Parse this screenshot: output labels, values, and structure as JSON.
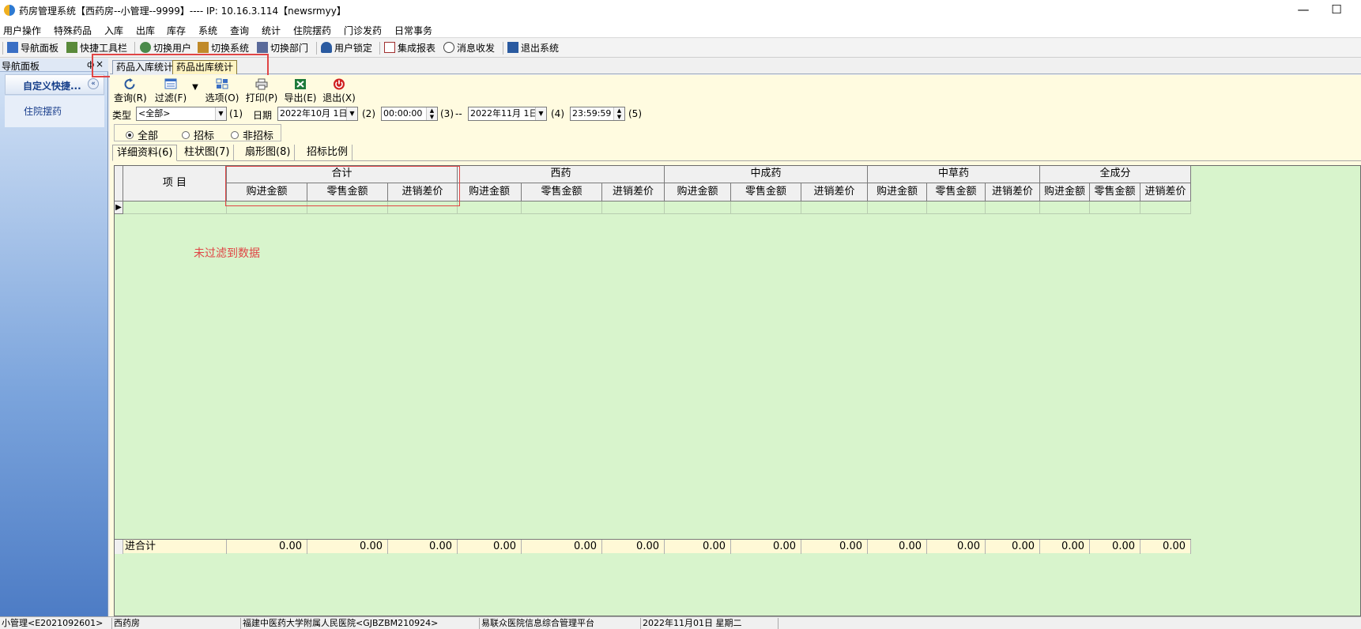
{
  "window": {
    "title": "药房管理系统【西药房--小管理--9999】---- IP: 10.16.3.114【newsrmyy】",
    "minimize": "—",
    "maximize": "☐"
  },
  "menu": [
    "用户操作",
    "特殊药品",
    "入库",
    "出库",
    "库存",
    "系统",
    "查询",
    "统计",
    "住院摆药",
    "门诊发药",
    "日常事务"
  ],
  "quickbar": [
    {
      "label": "导航面板",
      "icon": "nav-panel-icon",
      "color": "#3a6fc4"
    },
    {
      "label": "快捷工具栏",
      "icon": "toolbar-icon",
      "color": "#5a8a3a"
    },
    {
      "label": "切换用户",
      "icon": "switch-user-icon",
      "color": "#4a8a4a"
    },
    {
      "label": "切换系统",
      "icon": "switch-system-icon",
      "color": "#c08a2a"
    },
    {
      "label": "切换部门",
      "icon": "switch-dept-icon",
      "color": "#5a6a9a"
    },
    {
      "label": "用户锁定",
      "icon": "user-lock-icon",
      "color": "#2a5aa0"
    },
    {
      "label": "集成报表",
      "icon": "report-icon",
      "color": "#a03030"
    },
    {
      "label": "消息收发",
      "icon": "message-icon",
      "color": "#444444"
    },
    {
      "label": "退出系统",
      "icon": "exit-icon",
      "color": "#2a5aa0"
    }
  ],
  "nav": {
    "title": "导航面板",
    "pin": "ф",
    "close": "×",
    "group": "自定义快捷...",
    "collapse": "«",
    "item": "住院摆药"
  },
  "doc_tabs": [
    "药品入库统计",
    "药品出库统计"
  ],
  "toolbar": [
    {
      "label": "查询(R)",
      "icon": "refresh-icon",
      "color": "#2a5aa0"
    },
    {
      "label": "过滤(F)",
      "icon": "filter-icon",
      "color": "#3a6fc4"
    },
    {
      "label": "选项(O)",
      "icon": "options-icon",
      "color": "#3a6fc4"
    },
    {
      "label": "打印(P)",
      "icon": "print-icon",
      "color": "#555555"
    },
    {
      "label": "导出(E)",
      "icon": "excel-icon",
      "color": "#1e7a3a"
    },
    {
      "label": "退出(X)",
      "icon": "power-icon",
      "color": "#d02020"
    }
  ],
  "filters": {
    "type_label": "类型",
    "type_value": "<全部>",
    "k1": "(1)",
    "date_label": "日期",
    "date_from": "2022年10月 1日",
    "k2": "(2)",
    "time_from": "00:00:00",
    "k3": "(3)",
    "dash": "--",
    "date_to": "2022年11月 1日",
    "k4": "(4)",
    "time_to": "23:59:59",
    "k5": "(5)"
  },
  "radios": [
    {
      "label": "全部",
      "checked": true
    },
    {
      "label": "招标",
      "checked": false
    },
    {
      "label": "非招标",
      "checked": false
    }
  ],
  "inner_tabs": [
    "详细资料(6)",
    "柱状图(7)",
    "扇形图(8)",
    "招标比例"
  ],
  "table": {
    "item_header": "项 目",
    "groups": [
      "合计",
      "西药",
      "中成药",
      "中草药",
      "全成分"
    ],
    "sub": [
      "购进金额",
      "零售金额",
      "进销差价"
    ],
    "empty_message": "未过滤到数据",
    "footer_label": "进合计",
    "footer_values": [
      "0.00",
      "0.00",
      "0.00",
      "0.00",
      "0.00",
      "0.00",
      "0.00",
      "0.00",
      "0.00",
      "0.00",
      "0.00",
      "0.00",
      "0.00",
      "0.00",
      "0.00"
    ]
  },
  "status": [
    "小管理<E2021092601>",
    "西药房",
    "福建中医药大学附属人民医院<GJBZBM210924>",
    "易联众医院信息综合管理平台",
    "2022年11月01日 星期二",
    ""
  ]
}
